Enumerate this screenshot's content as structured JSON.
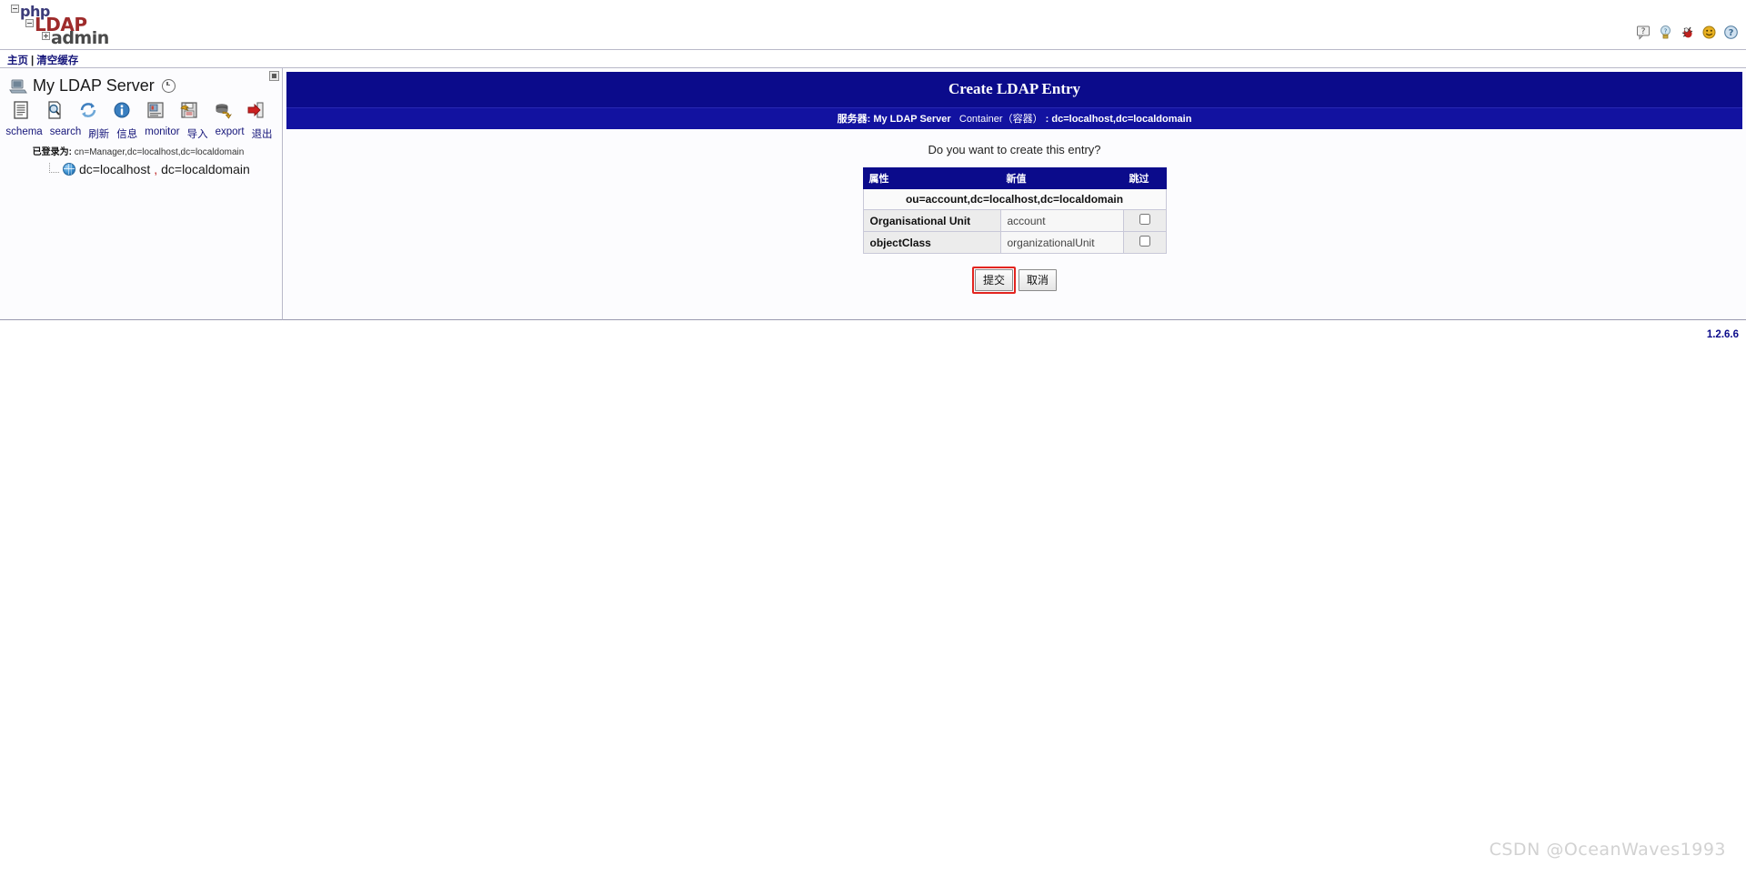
{
  "app": {
    "logo": {
      "line1": "php",
      "line2": "LDAP",
      "line3": "admin"
    },
    "version": "1.2.6.6",
    "watermark": "CSDN @OceanWaves1993"
  },
  "top_icons": [
    {
      "name": "question-bubble-icon",
      "title": "帮助"
    },
    {
      "name": "lightbulb-icon",
      "title": "提示"
    },
    {
      "name": "bug-icon",
      "title": "报告错误"
    },
    {
      "name": "smiley-icon",
      "title": "捐赠"
    },
    {
      "name": "help-icon",
      "title": "帮助"
    }
  ],
  "nav": {
    "home": "主页",
    "separator": "|",
    "purge_cache": "清空缓存"
  },
  "sidebar": {
    "server_name": "My LDAP Server",
    "tools": [
      {
        "icon": "schema-icon",
        "label": "schema"
      },
      {
        "icon": "search-icon",
        "label": "search"
      },
      {
        "icon": "refresh-icon",
        "label": "刷新"
      },
      {
        "icon": "info-icon",
        "label": "信息"
      },
      {
        "icon": "monitor-icon",
        "label": "monitor"
      },
      {
        "icon": "import-icon",
        "label": "导入"
      },
      {
        "icon": "export-icon",
        "label": "export"
      },
      {
        "icon": "logout-icon",
        "label": "退出"
      }
    ],
    "logged_in_label": "已登录为:",
    "logged_in_dn": "cn=Manager,dc=localhost,dc=localdomain",
    "tree": [
      {
        "label_part1": "dc=localhost",
        "comma": ",",
        "label_part2": "dc=localdomain"
      }
    ]
  },
  "main": {
    "title": "Create LDAP Entry",
    "breadcrumb": {
      "server_label": "服务器:",
      "server_name": "My LDAP Server",
      "container_label": "Container（容器）",
      "colon": ":",
      "container_dn": "dc=localhost,dc=localdomain"
    },
    "question": "Do you want to create this entry?",
    "table": {
      "headers": [
        "属性",
        "新值",
        "跳过"
      ],
      "dn_row": "ou=account,dc=localhost,dc=localdomain",
      "rows": [
        {
          "attribute": "Organisational Unit",
          "value": "account",
          "skip": false
        },
        {
          "attribute": "objectClass",
          "value": "organizationalUnit",
          "skip": false
        }
      ]
    },
    "buttons": {
      "submit": "提交",
      "cancel": "取消"
    }
  }
}
